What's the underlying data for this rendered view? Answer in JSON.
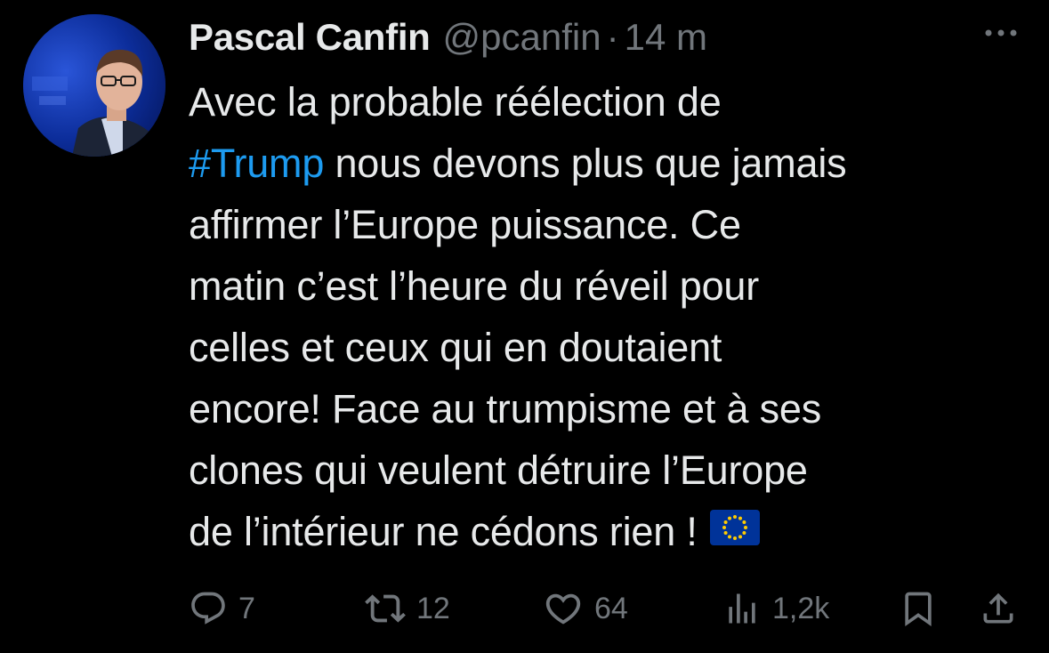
{
  "author": {
    "display_name": "Pascal Canfin",
    "handle": "@pcanfin",
    "separator": "·",
    "timestamp": "14 m"
  },
  "tweet": {
    "lines": [
      [
        "Avec la probable réélection de"
      ],
      [
        "#Trump",
        " nous devons plus que jamais"
      ],
      [
        "affirmer l’Europe puissance. Ce"
      ],
      [
        "matin c’est l’heure du réveil pour"
      ],
      [
        "celles et ceux qui en doutaient"
      ],
      [
        "encore! Face au trumpisme et à ses"
      ],
      [
        "clones qui veulent détruire l’Europe"
      ],
      [
        "de l’intérieur ne cédons rien !"
      ]
    ],
    "hashtag": "#Trump",
    "emoji": "eu-flag-icon"
  },
  "actions": {
    "replies": "7",
    "reposts": "12",
    "likes": "64",
    "views": "1,2k"
  },
  "colors": {
    "background": "#000000",
    "text": "#e7e9ea",
    "secondary": "#71767b",
    "hashtag": "#1d9bf0",
    "eu_blue": "#003399",
    "eu_gold": "#ffcc00"
  }
}
